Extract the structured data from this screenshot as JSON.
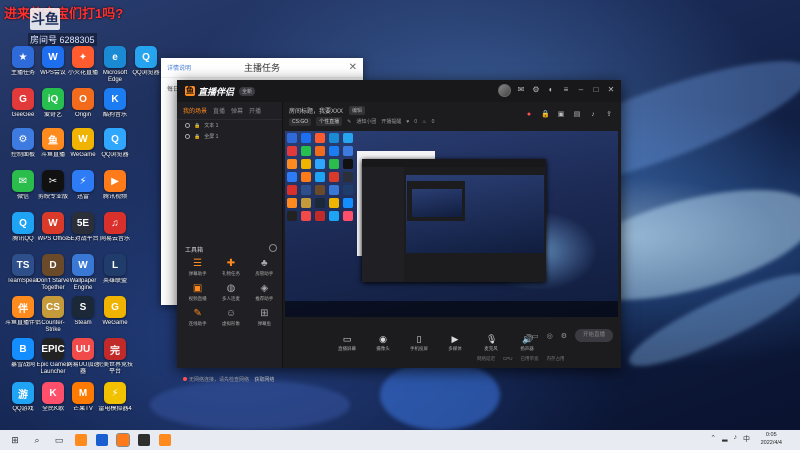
{
  "overlay": {
    "title_text": "进来的宝宝们打1吗?",
    "logo_text": "斗鱼",
    "room_text": "房间号 6288305"
  },
  "desktop_icons": [
    {
      "label": "主播任务",
      "color": "#2f6bd8",
      "glyph": "★"
    },
    {
      "label": "WPS会议",
      "color": "#1e6ef0",
      "glyph": "W"
    },
    {
      "label": "小火花直播",
      "color": "#ff5b2e",
      "glyph": "✦"
    },
    {
      "label": "Microsoft Edge",
      "color": "#1a8ad4",
      "glyph": "e"
    },
    {
      "label": "QQ浏览器",
      "color": "#26a4f0",
      "glyph": "Q"
    },
    {
      "label": "GeeGee",
      "color": "#e23a3a",
      "glyph": "G"
    },
    {
      "label": "爱奇艺",
      "color": "#27c04e",
      "glyph": "iQ"
    },
    {
      "label": "Origin",
      "color": "#f26a1b",
      "glyph": "O"
    },
    {
      "label": "酷狗音乐",
      "color": "#1c7cf2",
      "glyph": "K"
    },
    {
      "label": "控制面板",
      "color": "#3d7be0",
      "glyph": "⚙"
    },
    {
      "label": "斗鱼直播",
      "color": "#ff8a1d",
      "glyph": "鱼"
    },
    {
      "label": "WeGame",
      "color": "#f0b400",
      "glyph": "W"
    },
    {
      "label": "QQ浏览器",
      "color": "#2fa7ff",
      "glyph": "Q"
    },
    {
      "label": "微信",
      "color": "#2bbd4b",
      "glyph": "✉"
    },
    {
      "label": "剪映专业版",
      "color": "#111111",
      "glyph": "✂"
    },
    {
      "label": "迅雷",
      "color": "#2d7cf6",
      "glyph": "⚡"
    },
    {
      "label": "腾讯视频",
      "color": "#ff7b1a",
      "glyph": "▶"
    },
    {
      "label": "腾讯QQ",
      "color": "#1fa3f4",
      "glyph": "Q"
    },
    {
      "label": "WPS Office",
      "color": "#d93a2a",
      "glyph": "W"
    },
    {
      "label": "5E对战平台",
      "color": "#2a2f3a",
      "glyph": "5E"
    },
    {
      "label": "网易云音乐",
      "color": "#d9302c",
      "glyph": "♫"
    },
    {
      "label": "TeamSpeak",
      "color": "#2f4f8a",
      "glyph": "TS"
    },
    {
      "label": "Don't Starve Together",
      "color": "#6b4a2a",
      "glyph": "D"
    },
    {
      "label": "Wallpaper Engine",
      "color": "#3a78d6",
      "glyph": "W"
    },
    {
      "label": "英雄联盟",
      "color": "#1f3c6a",
      "glyph": "L"
    },
    {
      "label": "斗鱼直播伴侣",
      "color": "#ff8a1d",
      "glyph": "伴"
    },
    {
      "label": "Counter-Strike",
      "color": "#c59a3a",
      "glyph": "CS"
    },
    {
      "label": "Steam",
      "color": "#1b2838",
      "glyph": "S"
    },
    {
      "label": "WeGame",
      "color": "#f0b400",
      "glyph": "G"
    },
    {
      "label": "暴雪战网",
      "color": "#148eff",
      "glyph": "B"
    },
    {
      "label": "Epic Games Launcher",
      "color": "#222222",
      "glyph": "EPIC"
    },
    {
      "label": "网易UU加速器",
      "color": "#f04a4a",
      "glyph": "UU"
    },
    {
      "label": "完美世界竞技平台",
      "color": "#c22a2a",
      "glyph": "完"
    },
    {
      "label": "QQ游戏",
      "color": "#1fa3f4",
      "glyph": "游"
    },
    {
      "label": "全民K歌",
      "color": "#ff4f6a",
      "glyph": "K"
    },
    {
      "label": "芒果TV",
      "color": "#ff7a00",
      "glyph": "M"
    },
    {
      "label": "雷电模拟器4",
      "color": "#f2c200",
      "glyph": "⚡"
    }
  ],
  "task_window": {
    "title": "主播任务",
    "top_left": "详情说明",
    "side_text": "每日",
    "close": "✕"
  },
  "app": {
    "name": "直播伴侣",
    "version": "全新",
    "tabs": [
      "我的场景",
      "直播",
      "弹幕",
      "开播"
    ],
    "sources": [
      "文本 1",
      "全屏 1"
    ],
    "toolbox_label": "工具箱",
    "tools": [
      {
        "label": "弹幕助手",
        "icon": "☰",
        "hot": true
      },
      {
        "label": "礼物任务",
        "icon": "✚",
        "hot": true
      },
      {
        "label": "房管助手",
        "icon": "♣",
        "hot": false
      },
      {
        "label": "视频直播",
        "icon": "▣",
        "hot": true
      },
      {
        "label": "多人连麦",
        "icon": "◍",
        "hot": false
      },
      {
        "label": "推荐助手",
        "icon": "◈",
        "hot": false
      },
      {
        "label": "连线助手",
        "icon": "✎",
        "hot": true
      },
      {
        "label": "虚拟形象",
        "icon": "☺",
        "hot": false
      },
      {
        "label": "弹幕鱼",
        "icon": "⊞",
        "hot": false
      }
    ],
    "status_text": "无网络连接，请先检查网络",
    "status_extra": "获取网络",
    "room_title": "房间标题，我要XXX",
    "edit_label": "编辑",
    "game_chip": "CS:GO",
    "category_chip": "个性直播",
    "extra_chips": [
      "通知小团",
      "开播提醒"
    ],
    "fans_count": "0",
    "heat_count": "0",
    "controls": [
      {
        "label": "直播屏幕",
        "icon": "▭"
      },
      {
        "label": "摄像头",
        "icon": "◉"
      },
      {
        "label": "手机投屏",
        "icon": "▯"
      },
      {
        "label": "多媒体",
        "icon": "▶"
      },
      {
        "label": "麦克风",
        "icon": "🎙"
      },
      {
        "label": "扬声器",
        "icon": "🔊"
      }
    ],
    "start_button": "开始直播",
    "stats": [
      "网络延迟",
      "CPU",
      "已用带宽",
      "内存占用"
    ]
  },
  "taskbar": {
    "time": "0:05",
    "date": "2022/4/4",
    "language": "中"
  }
}
